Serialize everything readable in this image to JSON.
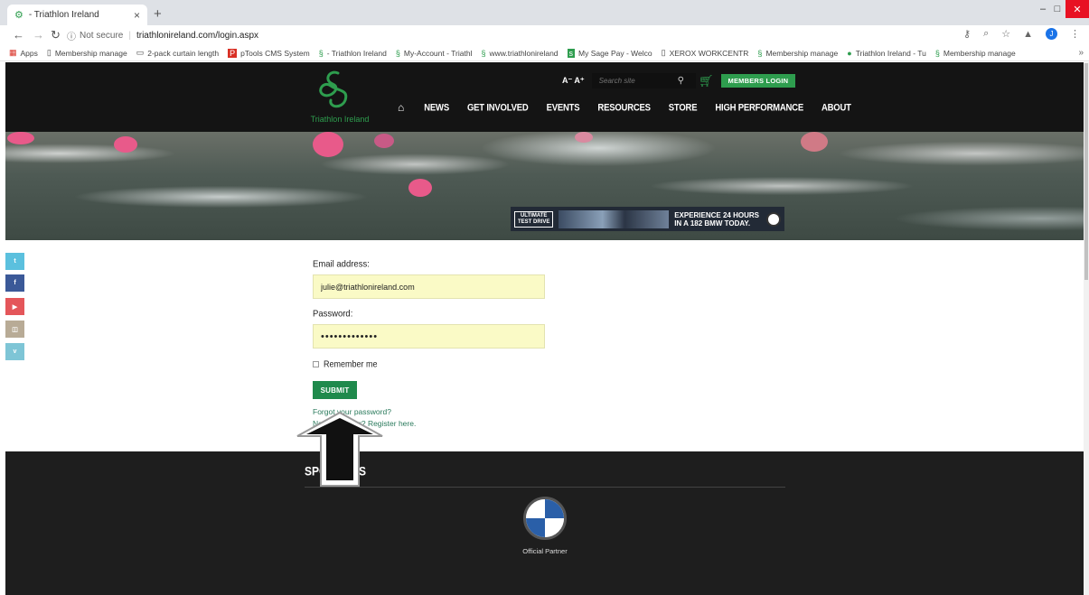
{
  "browser": {
    "tab_title": "- Triathlon Ireland",
    "security_label": "Not secure",
    "url": "triathlonireland.com/login.aspx",
    "avatar_letter": "J",
    "window_controls": [
      "–",
      "□",
      "✕"
    ],
    "bookmarks": [
      {
        "icon": "apps-icon",
        "label": "Apps"
      },
      {
        "icon": "page-icon",
        "label": "Membership manage"
      },
      {
        "icon": "page-icon",
        "label": "2-pack curtain length"
      },
      {
        "icon": "ptools-icon",
        "label": "pTools CMS System"
      },
      {
        "icon": "triathlon-icon",
        "label": "- Triathlon Ireland"
      },
      {
        "icon": "triathlon-icon",
        "label": "My-Account - Triathl"
      },
      {
        "icon": "triathlon-icon",
        "label": "www.triathlonireland"
      },
      {
        "icon": "sage-icon",
        "label": "My Sage Pay - Welco"
      },
      {
        "icon": "page-icon",
        "label": "XEROX WORKCENTR"
      },
      {
        "icon": "triathlon-icon",
        "label": "Membership manage"
      },
      {
        "icon": "triathlon-icon",
        "label": "Triathlon Ireland - Tu"
      },
      {
        "icon": "triathlon-icon",
        "label": "Membership manage"
      }
    ],
    "bookmarks_overflow": "»"
  },
  "header": {
    "logo_text": "Triathlon Ireland",
    "font_size_toggle": "A⁻ A⁺",
    "search_placeholder": "Search site",
    "members_login": "MEMBERS LOGIN",
    "nav": [
      "NEWS",
      "GET INVOLVED",
      "EVENTS",
      "RESOURCES",
      "STORE",
      "HIGH PERFORMANCE",
      "ABOUT"
    ]
  },
  "banner_ad": {
    "label_line1": "ULTIMATE",
    "label_line2": "TEST DRIVE",
    "copy_line1": "EXPERIENCE 24 HOURS",
    "copy_line2": "IN A 182 BMW TODAY."
  },
  "social": [
    "twitter-icon",
    "facebook-icon",
    "youtube-icon",
    "instagram-icon",
    "vimeo-icon"
  ],
  "form": {
    "email_label": "Email address:",
    "email_value": "julie@triathlonireland.com",
    "password_label": "Password:",
    "password_value": "•••••••••••••",
    "remember_label": "Remember me",
    "submit_label": "SUBMIT",
    "forgot_link": "Forgot your password?",
    "register_link": "Not a member? Register here."
  },
  "footer": {
    "sponsors_title": "SPONSORS",
    "sponsor_caption": "Official Partner"
  },
  "colors": {
    "brand_green": "#2e9d4e",
    "submit_green": "#1f8a4c",
    "header_bg": "#141414",
    "footer_bg": "#1e1e1e",
    "input_bg": "#fafac6"
  }
}
